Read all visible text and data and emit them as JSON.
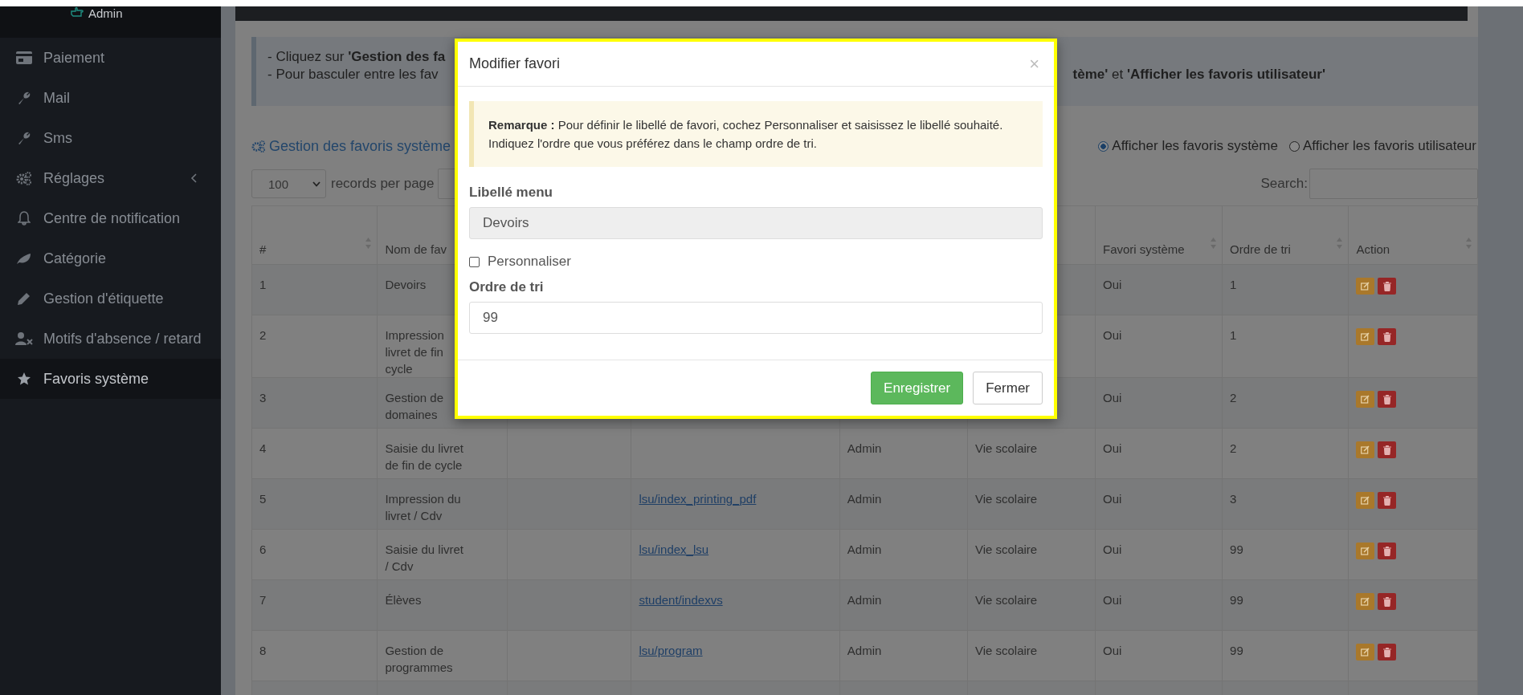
{
  "sidebar": {
    "user": "Admin",
    "items": [
      {
        "label": "Paiement",
        "selected": false,
        "expandable": false
      },
      {
        "label": "Mail",
        "selected": false,
        "expandable": false
      },
      {
        "label": "Sms",
        "selected": false,
        "expandable": false
      },
      {
        "label": "Réglages",
        "selected": false,
        "expandable": true
      },
      {
        "label": "Centre de notification",
        "selected": false,
        "expandable": false
      },
      {
        "label": "Catégorie",
        "selected": false,
        "expandable": false
      },
      {
        "label": "Gestion d'étiquette",
        "selected": false,
        "expandable": false
      },
      {
        "label": "Motifs d'absence / retard",
        "selected": false,
        "expandable": false
      },
      {
        "label": "Favoris système",
        "selected": true,
        "expandable": false
      }
    ]
  },
  "banner": {
    "line_1": "- Cliquez sur **'Gestion des fa**",
    "line_2_start": "- Pour basculer entre les fav",
    "line_2_end": "**tème'** et **'Afficher les favoris utilisateur'**"
  },
  "toolbar": {
    "title": "Gestion des favoris système",
    "radios": [
      {
        "label": "Afficher les favoris système",
        "selected": true
      },
      {
        "label": "Afficher les favoris utilisateur",
        "selected": false
      }
    ]
  },
  "table_controls": {
    "page_size": "100",
    "page_size_label": "records per page",
    "search_label": "Search:"
  },
  "table": {
    "columns": {
      "number": "#",
      "name": "Nom de fav",
      "system": "Favori système",
      "order": "Ordre de tri",
      "action": "Action"
    },
    "rows": [
      {
        "number": "1",
        "name": "Devoirs",
        "system": "Oui",
        "order": "1"
      },
      {
        "number": "2",
        "name": "Impression livret de fin cycle",
        "system": "Oui",
        "order": "1"
      },
      {
        "number": "3",
        "name": "Gestion de domaines",
        "system": "Oui",
        "order": "2"
      },
      {
        "number": "4",
        "name": "Saisie du livret de fin de cycle",
        "author": "Admin",
        "category": "Vie scolaire",
        "system": "Oui",
        "order": "2"
      },
      {
        "number": "5",
        "name": "Impression du livret / Cdv",
        "link": "lsu/index_printing_pdf",
        "author": "Admin",
        "category": "Vie scolaire",
        "system": "Oui",
        "order": "3"
      },
      {
        "number": "6",
        "name": "Saisie du livret / Cdv",
        "link": "lsu/index_lsu",
        "author": "Admin",
        "category": "Vie scolaire",
        "system": "Oui",
        "order": "99"
      },
      {
        "number": "7",
        "name": "Élèves",
        "link": "student/indexvs",
        "author": "Admin",
        "category": "Vie scolaire",
        "system": "Oui",
        "order": "99"
      },
      {
        "number": "8",
        "name": "Gestion de programmes",
        "link": "lsu/program",
        "author": "Admin",
        "category": "Vie scolaire",
        "system": "Oui",
        "order": "99"
      }
    ]
  },
  "modal": {
    "title": "Modifier favori",
    "close": "×",
    "note": "**Remarque :** Pour définir le libellé de favori, cochez Personnaliser et saisissez le libellé souhaité. Indiquez l'ordre que vous préférez dans le champ ordre de tri.",
    "menu_field": {
      "label": "Libellé menu",
      "value": "Devoirs",
      "disabled": true
    },
    "customize": {
      "label": "Personnaliser",
      "checked": false
    },
    "order_field": {
      "label": "Ordre de tri",
      "value": "99"
    },
    "buttons": [
      {
        "label": "Enregistrer",
        "kind": "primary"
      },
      {
        "label": "Fermer",
        "kind": "default"
      }
    ]
  }
}
